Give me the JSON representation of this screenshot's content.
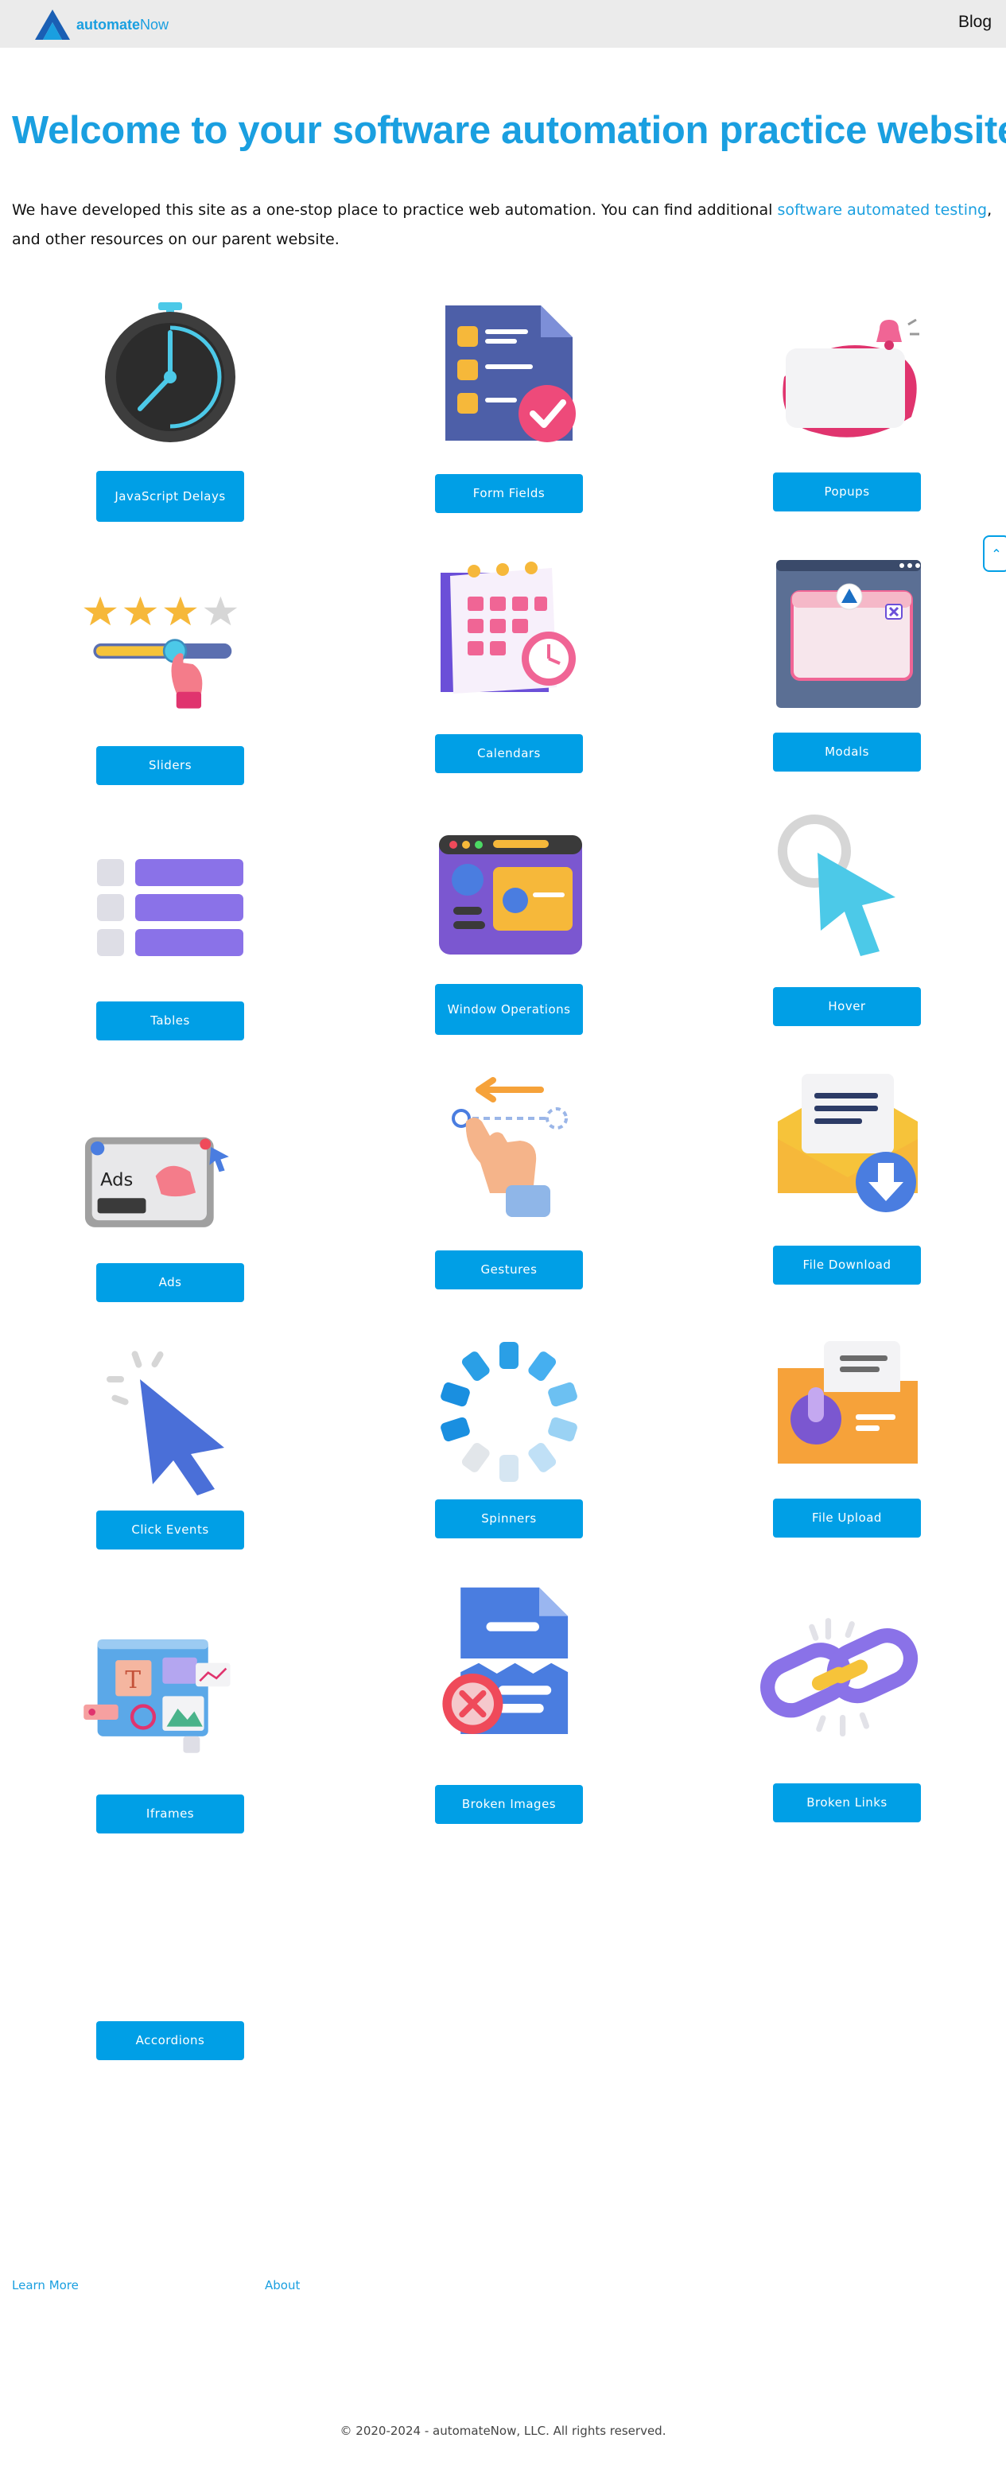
{
  "header": {
    "logo_bold": "automate",
    "logo_light": "Now",
    "blog_label": "Blog"
  },
  "main": {
    "title": "Welcome to your software automation practice website!",
    "intro_prefix": "We have developed this site as a one-stop place to practice web automation. You can find additional ",
    "intro_link": "software automated testing",
    "intro_suffix": ", and other resources on our parent website."
  },
  "cards": [
    {
      "label": "JavaScript Delays",
      "icon": "stopwatch-icon"
    },
    {
      "label": "Form Fields",
      "icon": "form-document-icon"
    },
    {
      "label": "Popups",
      "icon": "popup-bell-icon"
    },
    {
      "label": "Sliders",
      "icon": "star-slider-icon"
    },
    {
      "label": "Calendars",
      "icon": "calendar-icon"
    },
    {
      "label": "Modals",
      "icon": "modal-window-icon"
    },
    {
      "label": "Tables",
      "icon": "table-rows-icon"
    },
    {
      "label": "Window Operations",
      "icon": "browser-window-icon"
    },
    {
      "label": "Hover",
      "icon": "cursor-hover-icon"
    },
    {
      "label": "Ads",
      "icon": "ad-banner-icon"
    },
    {
      "label": "Gestures",
      "icon": "swipe-hand-icon"
    },
    {
      "label": "File Download",
      "icon": "envelope-download-icon"
    },
    {
      "label": "Click Events",
      "icon": "cursor-click-icon"
    },
    {
      "label": "Spinners",
      "icon": "spinner-icon"
    },
    {
      "label": "File Upload",
      "icon": "folder-upload-icon"
    },
    {
      "label": "Iframes",
      "icon": "iframe-collage-icon"
    },
    {
      "label": "Broken Images",
      "icon": "broken-image-icon"
    },
    {
      "label": "Broken Links",
      "icon": "broken-chain-icon"
    },
    {
      "label": "Accordions",
      "icon": ""
    }
  ],
  "footer": {
    "learn_more": "Learn More",
    "about": "About",
    "copyright": "© 2020-2024 - automateNow, LLC. All rights reserved."
  },
  "colors": {
    "brand": "#1a9fe0",
    "button": "#009fe6",
    "topbar": "#ebebeb"
  }
}
